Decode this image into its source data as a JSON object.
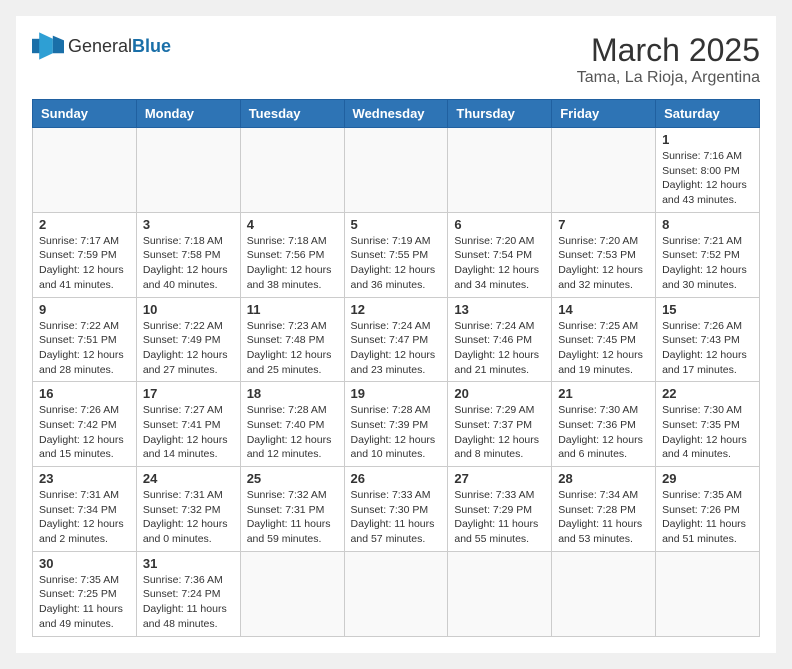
{
  "header": {
    "logo_general": "General",
    "logo_blue": "Blue",
    "title": "March 2025",
    "subtitle": "Tama, La Rioja, Argentina"
  },
  "weekdays": [
    "Sunday",
    "Monday",
    "Tuesday",
    "Wednesday",
    "Thursday",
    "Friday",
    "Saturday"
  ],
  "weeks": [
    [
      {
        "day": "",
        "info": ""
      },
      {
        "day": "",
        "info": ""
      },
      {
        "day": "",
        "info": ""
      },
      {
        "day": "",
        "info": ""
      },
      {
        "day": "",
        "info": ""
      },
      {
        "day": "",
        "info": ""
      },
      {
        "day": "1",
        "info": "Sunrise: 7:16 AM\nSunset: 8:00 PM\nDaylight: 12 hours\nand 43 minutes."
      }
    ],
    [
      {
        "day": "2",
        "info": "Sunrise: 7:17 AM\nSunset: 7:59 PM\nDaylight: 12 hours\nand 41 minutes."
      },
      {
        "day": "3",
        "info": "Sunrise: 7:18 AM\nSunset: 7:58 PM\nDaylight: 12 hours\nand 40 minutes."
      },
      {
        "day": "4",
        "info": "Sunrise: 7:18 AM\nSunset: 7:56 PM\nDaylight: 12 hours\nand 38 minutes."
      },
      {
        "day": "5",
        "info": "Sunrise: 7:19 AM\nSunset: 7:55 PM\nDaylight: 12 hours\nand 36 minutes."
      },
      {
        "day": "6",
        "info": "Sunrise: 7:20 AM\nSunset: 7:54 PM\nDaylight: 12 hours\nand 34 minutes."
      },
      {
        "day": "7",
        "info": "Sunrise: 7:20 AM\nSunset: 7:53 PM\nDaylight: 12 hours\nand 32 minutes."
      },
      {
        "day": "8",
        "info": "Sunrise: 7:21 AM\nSunset: 7:52 PM\nDaylight: 12 hours\nand 30 minutes."
      }
    ],
    [
      {
        "day": "9",
        "info": "Sunrise: 7:22 AM\nSunset: 7:51 PM\nDaylight: 12 hours\nand 28 minutes."
      },
      {
        "day": "10",
        "info": "Sunrise: 7:22 AM\nSunset: 7:49 PM\nDaylight: 12 hours\nand 27 minutes."
      },
      {
        "day": "11",
        "info": "Sunrise: 7:23 AM\nSunset: 7:48 PM\nDaylight: 12 hours\nand 25 minutes."
      },
      {
        "day": "12",
        "info": "Sunrise: 7:24 AM\nSunset: 7:47 PM\nDaylight: 12 hours\nand 23 minutes."
      },
      {
        "day": "13",
        "info": "Sunrise: 7:24 AM\nSunset: 7:46 PM\nDaylight: 12 hours\nand 21 minutes."
      },
      {
        "day": "14",
        "info": "Sunrise: 7:25 AM\nSunset: 7:45 PM\nDaylight: 12 hours\nand 19 minutes."
      },
      {
        "day": "15",
        "info": "Sunrise: 7:26 AM\nSunset: 7:43 PM\nDaylight: 12 hours\nand 17 minutes."
      }
    ],
    [
      {
        "day": "16",
        "info": "Sunrise: 7:26 AM\nSunset: 7:42 PM\nDaylight: 12 hours\nand 15 minutes."
      },
      {
        "day": "17",
        "info": "Sunrise: 7:27 AM\nSunset: 7:41 PM\nDaylight: 12 hours\nand 14 minutes."
      },
      {
        "day": "18",
        "info": "Sunrise: 7:28 AM\nSunset: 7:40 PM\nDaylight: 12 hours\nand 12 minutes."
      },
      {
        "day": "19",
        "info": "Sunrise: 7:28 AM\nSunset: 7:39 PM\nDaylight: 12 hours\nand 10 minutes."
      },
      {
        "day": "20",
        "info": "Sunrise: 7:29 AM\nSunset: 7:37 PM\nDaylight: 12 hours\nand 8 minutes."
      },
      {
        "day": "21",
        "info": "Sunrise: 7:30 AM\nSunset: 7:36 PM\nDaylight: 12 hours\nand 6 minutes."
      },
      {
        "day": "22",
        "info": "Sunrise: 7:30 AM\nSunset: 7:35 PM\nDaylight: 12 hours\nand 4 minutes."
      }
    ],
    [
      {
        "day": "23",
        "info": "Sunrise: 7:31 AM\nSunset: 7:34 PM\nDaylight: 12 hours\nand 2 minutes."
      },
      {
        "day": "24",
        "info": "Sunrise: 7:31 AM\nSunset: 7:32 PM\nDaylight: 12 hours\nand 0 minutes."
      },
      {
        "day": "25",
        "info": "Sunrise: 7:32 AM\nSunset: 7:31 PM\nDaylight: 11 hours\nand 59 minutes."
      },
      {
        "day": "26",
        "info": "Sunrise: 7:33 AM\nSunset: 7:30 PM\nDaylight: 11 hours\nand 57 minutes."
      },
      {
        "day": "27",
        "info": "Sunrise: 7:33 AM\nSunset: 7:29 PM\nDaylight: 11 hours\nand 55 minutes."
      },
      {
        "day": "28",
        "info": "Sunrise: 7:34 AM\nSunset: 7:28 PM\nDaylight: 11 hours\nand 53 minutes."
      },
      {
        "day": "29",
        "info": "Sunrise: 7:35 AM\nSunset: 7:26 PM\nDaylight: 11 hours\nand 51 minutes."
      }
    ],
    [
      {
        "day": "30",
        "info": "Sunrise: 7:35 AM\nSunset: 7:25 PM\nDaylight: 11 hours\nand 49 minutes."
      },
      {
        "day": "31",
        "info": "Sunrise: 7:36 AM\nSunset: 7:24 PM\nDaylight: 11 hours\nand 48 minutes."
      },
      {
        "day": "",
        "info": ""
      },
      {
        "day": "",
        "info": ""
      },
      {
        "day": "",
        "info": ""
      },
      {
        "day": "",
        "info": ""
      },
      {
        "day": "",
        "info": ""
      }
    ]
  ]
}
